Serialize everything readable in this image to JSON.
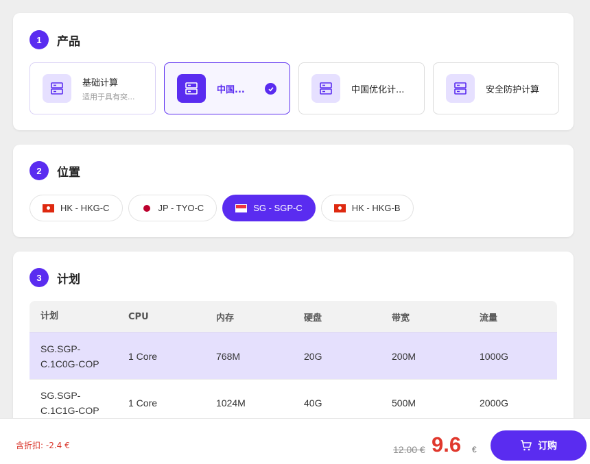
{
  "sections": {
    "product": {
      "num": "1",
      "title": "产品"
    },
    "location": {
      "num": "2",
      "title": "位置"
    },
    "plan": {
      "num": "3",
      "title": "计划"
    }
  },
  "products": [
    {
      "name": "基础计算",
      "desc": "适用于具有突...",
      "icon": "server-icon"
    },
    {
      "name": "中国...",
      "desc": "",
      "icon": "server-icon",
      "selected": true
    },
    {
      "name": "中国优化计...",
      "desc": "",
      "icon": "server-icon"
    },
    {
      "name": "安全防护计算",
      "desc": "",
      "icon": "server-icon"
    }
  ],
  "locations": [
    {
      "label": "HK - HKG-C",
      "flag": "hk-flag"
    },
    {
      "label": "JP - TYO-C",
      "flag": "jp-flag"
    },
    {
      "label": "SG - SGP-C",
      "flag": "sg-flag",
      "selected": true
    },
    {
      "label": "HK - HKG-B",
      "flag": "hk-flag"
    }
  ],
  "plan_table": {
    "headers": [
      "计划",
      "CPU",
      "内存",
      "硬盘",
      "带宽",
      "流量"
    ],
    "rows": [
      {
        "plan_line1": "SG.SGP-",
        "plan_line2": "C.1C0G-COP",
        "cpu": "1 Core",
        "mem": "768M",
        "disk": "20G",
        "bw": "200M",
        "traffic": "1000G",
        "selected": true
      },
      {
        "plan_line1": "SG.SGP-",
        "plan_line2": "C.1C1G-COP",
        "cpu": "1 Core",
        "mem": "1024M",
        "disk": "40G",
        "bw": "500M",
        "traffic": "2000G"
      }
    ]
  },
  "footer": {
    "discount": "含折扣: -2.4 €",
    "old_price": "12.00 €",
    "price": "9.6",
    "currency": "€",
    "buy_label": "订购"
  },
  "colors": {
    "accent": "#5a2cf0",
    "price": "#e0382d",
    "selected_row": "#e5e0fd"
  }
}
